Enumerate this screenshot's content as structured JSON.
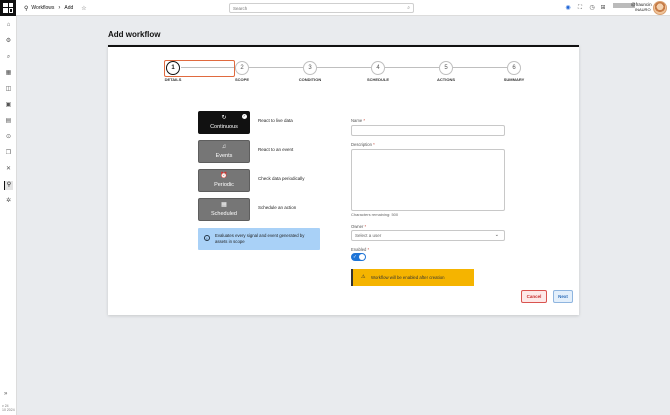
{
  "header": {
    "breadcrumb": [
      "Workflows",
      "Add"
    ],
    "search_placeholder": "Search",
    "user_name": "@frauncin",
    "user_org": "INAURO"
  },
  "sidebar": {
    "icons": [
      "home-icon",
      "settings-gear-icon",
      "search-icon",
      "dashboard-icon",
      "map-icon",
      "box-icon",
      "document-icon",
      "magnify-icon",
      "copy-icon",
      "tools-icon",
      "workflow-icon",
      "cog-icon"
    ],
    "active": "workflow-icon",
    "footer_version": "v 24",
    "footer_date": "10 2024"
  },
  "page": {
    "title": "Add workflow"
  },
  "stepper": {
    "steps": [
      {
        "number": "1",
        "label": "DETAILS",
        "active": true
      },
      {
        "number": "2",
        "label": "SCOPE",
        "active": false
      },
      {
        "number": "3",
        "label": "CONDITION",
        "active": false
      },
      {
        "number": "4",
        "label": "SCHEDULE",
        "active": false
      },
      {
        "number": "5",
        "label": "ACTIONS",
        "active": false
      },
      {
        "number": "6",
        "label": "SUMMARY",
        "active": false
      }
    ]
  },
  "types": [
    {
      "label": "Continuous",
      "icon": "refresh-icon",
      "description": "React to live data",
      "selected": true
    },
    {
      "label": "Events",
      "icon": "bell-icon",
      "description": "React to an event",
      "selected": false
    },
    {
      "label": "Periodic",
      "icon": "alarm-clock-icon",
      "description": "Check data periodically",
      "selected": false
    },
    {
      "label": "Scheduled",
      "icon": "calendar-icon",
      "description": "Schedule an action",
      "selected": false
    }
  ],
  "info_text": "Evaluates every signal and event generated by assets in scope",
  "form": {
    "name_label": "Name",
    "name_value": "",
    "description_label": "Description",
    "description_value": "",
    "chars_remaining": "Characters remaining: 500",
    "owner_label": "Owner",
    "owner_placeholder": "Select a user",
    "enabled_label": "Enabled",
    "enabled": true,
    "warning": "Workflow will be enabled after creation",
    "required_mark": "*"
  },
  "buttons": {
    "cancel": "Cancel",
    "next": "Next"
  },
  "colors": {
    "accent": "#1e74d6",
    "warning": "#f5b400",
    "info": "#a9d1f7",
    "cancel": "#c62828",
    "focus": "#e06a3f"
  }
}
